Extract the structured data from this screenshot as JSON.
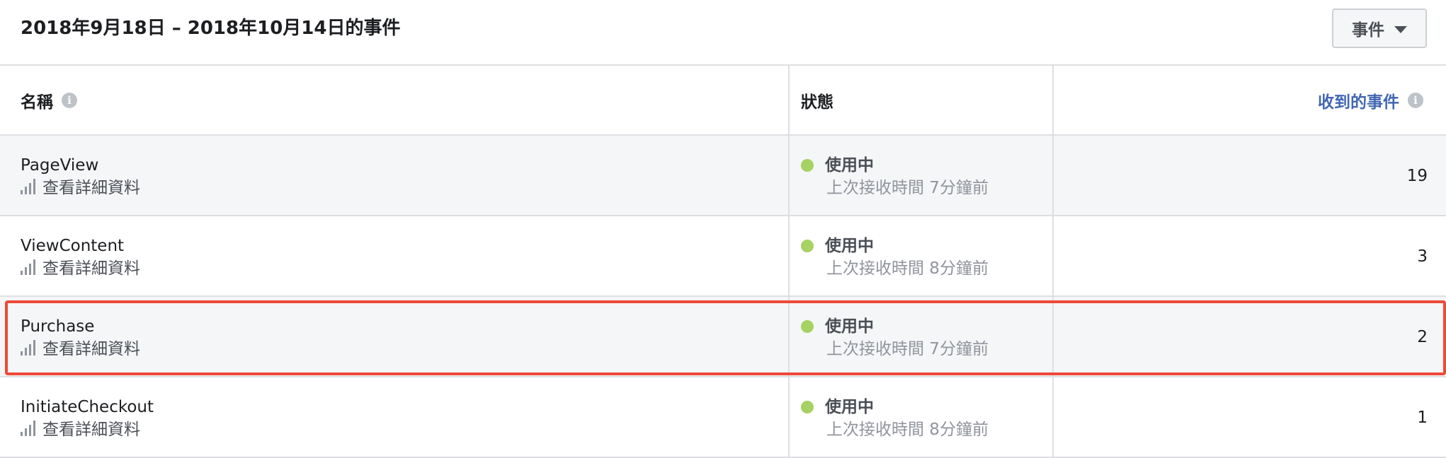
{
  "header": {
    "date_range_title": "2018年9月18日 – 2018年10月14日的事件",
    "event_dropdown_label": "事件"
  },
  "table": {
    "columns": {
      "name": "名稱",
      "status": "狀態",
      "received": "收到的事件"
    },
    "rows": [
      {
        "name": "PageView",
        "details_label": "查看詳細資料",
        "status": "使用中",
        "last_received": "上次接收時間 7分鐘前",
        "count": "19"
      },
      {
        "name": "ViewContent",
        "details_label": "查看詳細資料",
        "status": "使用中",
        "last_received": "上次接收時間 8分鐘前",
        "count": "3"
      },
      {
        "name": "Purchase",
        "details_label": "查看詳細資料",
        "status": "使用中",
        "last_received": "上次接收時間 7分鐘前",
        "count": "2"
      },
      {
        "name": "InitiateCheckout",
        "details_label": "查看詳細資料",
        "status": "使用中",
        "last_received": "上次接收時間 8分鐘前",
        "count": "1"
      }
    ]
  },
  "colors": {
    "active_dot": "#a6d163",
    "link_blue": "#4267b2",
    "highlight_border": "#ec4a38",
    "alt_row_bg": "#f5f6f7"
  },
  "icons": {
    "info": "info-icon",
    "caret": "caret-down-icon",
    "details": "bar-chart-icon",
    "status": "status-dot-icon"
  },
  "highlighted_row": "Purchase"
}
